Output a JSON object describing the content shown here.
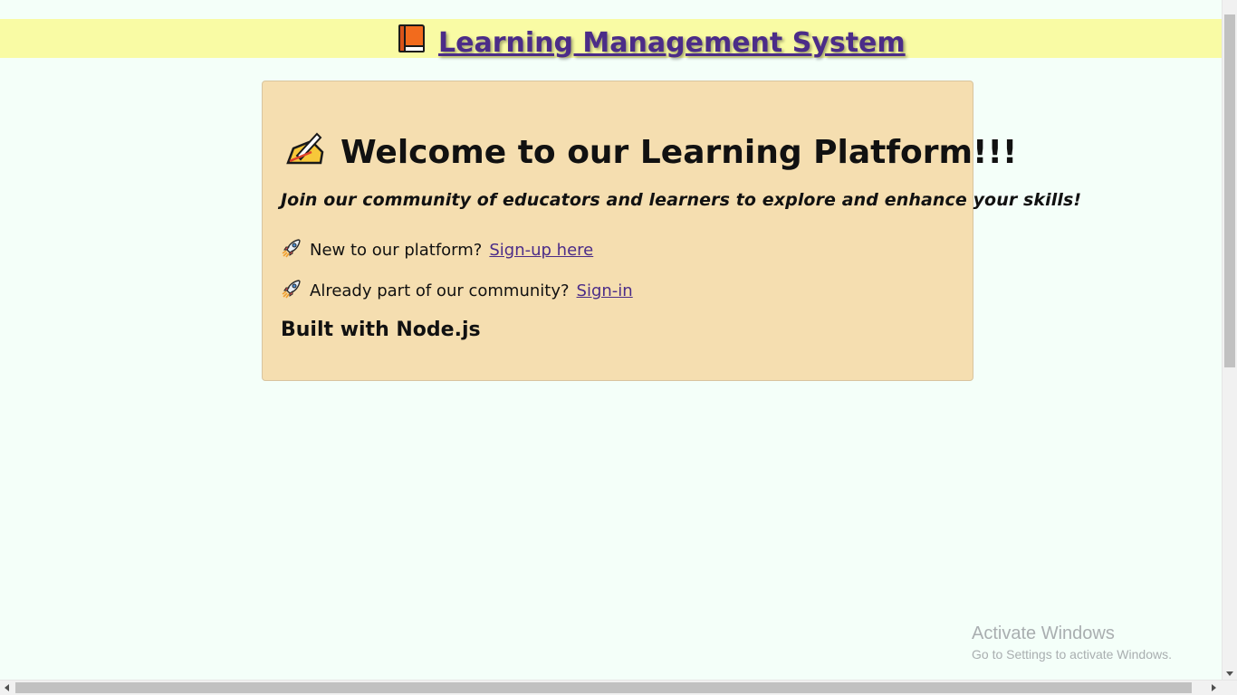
{
  "header": {
    "title": "Learning Management System",
    "icon": "orange-book-icon"
  },
  "card": {
    "heading": "Welcome to our Learning Platform!!!",
    "heading_icon": "writing-hand-icon",
    "tagline": "Join our community of educators and learners to explore and enhance your skills!",
    "signup_prompt": "New to our platform?",
    "signup_link": "Sign-up here",
    "signin_prompt": "Already part of our community?",
    "signin_link": "Sign-in",
    "line_icon": "rocket-icon",
    "footer": "Built with Node.js"
  },
  "watermark": {
    "line1": "Activate Windows",
    "line2": "Go to Settings to activate Windows."
  },
  "colors": {
    "page_bg": "#f4fff9",
    "banner_bg": "#f9fba4",
    "card_bg": "#f5deb0",
    "link": "#4b2c88"
  }
}
